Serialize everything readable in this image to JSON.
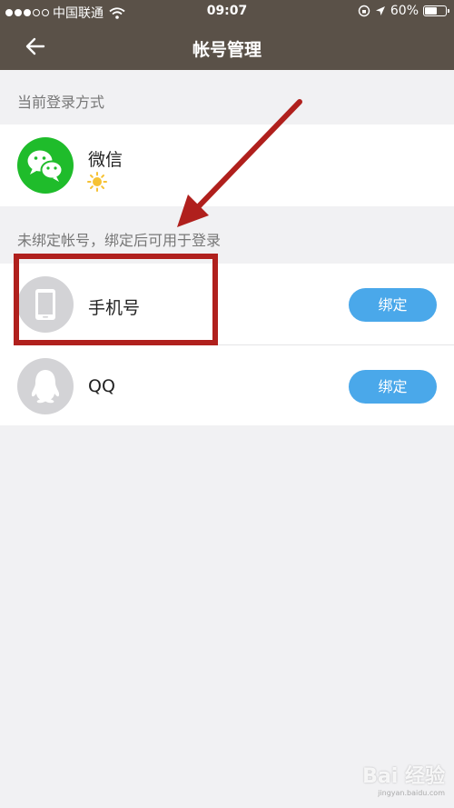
{
  "status_bar": {
    "carrier": "中国联通",
    "time": "09:07",
    "battery": "60%",
    "signal_dots_filled": 3,
    "signal_dots_total": 5,
    "battery_level": 0.6
  },
  "header": {
    "title": "帐号管理",
    "back_icon": "arrow-left-icon"
  },
  "current_login": {
    "section_label": "当前登录方式",
    "method": {
      "name": "微信",
      "icon": "wechat-icon",
      "badge_icon": "sun-icon"
    }
  },
  "unbound": {
    "section_label": "未绑定帐号，绑定后可用于登录",
    "accounts": [
      {
        "name": "手机号",
        "icon": "phone-icon",
        "button": "绑定"
      },
      {
        "name": "QQ",
        "icon": "qq-icon",
        "button": "绑定"
      }
    ]
  },
  "annotation": {
    "color": "#b0201d"
  },
  "colors": {
    "nav_bg": "#5a5148",
    "button": "#4aa8ea",
    "wechat": "#1fbc2b"
  },
  "watermark": {
    "text": "Bai 经验",
    "url": "jingyan.baidu.com"
  }
}
